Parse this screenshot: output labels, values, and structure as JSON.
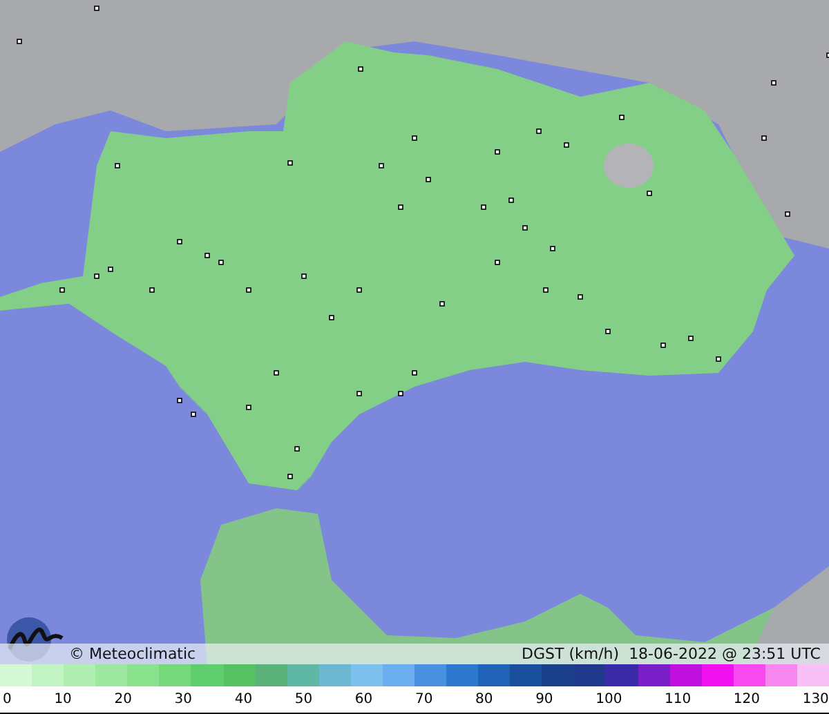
{
  "map": {
    "caption": {
      "copyright": "© Meteoclimatic",
      "title": "DGST (km/h)  18-06-2022 @ 23:51 UTC"
    }
  },
  "legend": {
    "colors": [
      {
        "color": "#d4f8d4"
      },
      {
        "color": "#c2f3c2"
      },
      {
        "color": "#b0eeb2"
      },
      {
        "color": "#9de8a0"
      },
      {
        "color": "#8ae28e"
      },
      {
        "color": "#76da7c"
      },
      {
        "color": "#5fce6c"
      },
      {
        "color": "#55c162"
      },
      {
        "color": "#5ab27a"
      },
      {
        "color": "#5fb8a6"
      },
      {
        "color": "#6cb8d0"
      },
      {
        "color": "#7cc0ee"
      },
      {
        "color": "#6aaef0"
      },
      {
        "color": "#4a90e0"
      },
      {
        "color": "#2f78d0"
      },
      {
        "color": "#1f62b8"
      },
      {
        "color": "#1a4f9e"
      },
      {
        "color": "#183f88"
      },
      {
        "color": "#1f3a8c"
      },
      {
        "color": "#3a2aa8"
      },
      {
        "color": "#7a1fc8"
      },
      {
        "color": "#c010e0"
      },
      {
        "color": "#f010f0"
      },
      {
        "color": "#f848f0"
      },
      {
        "color": "#f888f0"
      },
      {
        "color": "#f8c0f4"
      }
    ],
    "ticks": [
      "0",
      "10",
      "20",
      "30",
      "40",
      "50",
      "60",
      "70",
      "80",
      "90",
      "100",
      "110",
      "120",
      "130"
    ]
  }
}
